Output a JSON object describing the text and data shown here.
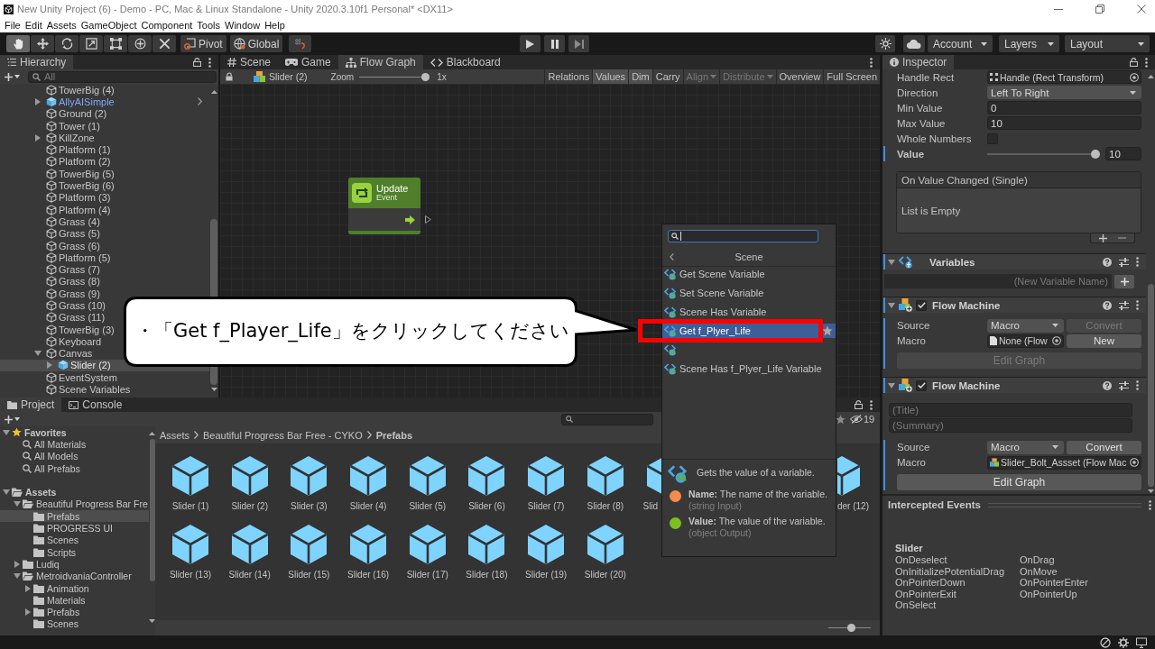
{
  "window": {
    "title": "New Unity Project (6) - Demo - PC, Mac & Linux Standalone - Unity 2020.3.10f1 Personal* <DX11>"
  },
  "menu": [
    "File",
    "Edit",
    "Assets",
    "GameObject",
    "Component",
    "Tools",
    "Window",
    "Help"
  ],
  "toolbar": {
    "tools": [
      {
        "kind": "hand",
        "selected": true
      },
      {
        "kind": "move",
        "selected": false
      },
      {
        "kind": "rotate",
        "selected": false
      },
      {
        "kind": "scale",
        "selected": false
      },
      {
        "kind": "rect",
        "selected": false
      },
      {
        "kind": "transform",
        "selected": false
      },
      {
        "kind": "custom",
        "selected": false
      }
    ],
    "pivot": "Pivot",
    "space": "Global",
    "account": "Account",
    "layers": "Layers",
    "layout": "Layout"
  },
  "hierarchy": {
    "title": "Hierarchy",
    "search_placeholder": "All",
    "items": [
      {
        "label": "TowerBig (4)",
        "kind": "object",
        "selected": false
      },
      {
        "label": "AllyAISimple",
        "kind": "prefab_root",
        "expanded": false,
        "selected": false
      },
      {
        "label": "Ground (2)",
        "kind": "object",
        "selected": false
      },
      {
        "label": "Tower (1)",
        "kind": "object",
        "selected": false
      },
      {
        "label": "KillZone",
        "kind": "object",
        "expanded": false,
        "selected": false
      },
      {
        "label": "Platform (1)",
        "kind": "object",
        "selected": false
      },
      {
        "label": "Platform (2)",
        "kind": "object",
        "selected": false
      },
      {
        "label": "TowerBig (5)",
        "kind": "object",
        "selected": false
      },
      {
        "label": "TowerBig (6)",
        "kind": "object",
        "selected": false
      },
      {
        "label": "Platform (3)",
        "kind": "object",
        "selected": false
      },
      {
        "label": "Platform (4)",
        "kind": "object",
        "selected": false
      },
      {
        "label": "Grass (4)",
        "kind": "object",
        "selected": false
      },
      {
        "label": "Grass (5)",
        "kind": "object",
        "selected": false
      },
      {
        "label": "Grass (6)",
        "kind": "object",
        "selected": false
      },
      {
        "label": "Platform (5)",
        "kind": "object",
        "selected": false
      },
      {
        "label": "Grass (7)",
        "kind": "object",
        "selected": false
      },
      {
        "label": "Grass (8)",
        "kind": "object",
        "selected": false
      },
      {
        "label": "Grass (9)",
        "kind": "object",
        "selected": false
      },
      {
        "label": "Grass (10)",
        "kind": "object",
        "selected": false
      },
      {
        "label": "Grass (11)",
        "kind": "object",
        "selected": false
      },
      {
        "label": "TowerBig (3)",
        "kind": "object",
        "selected": false
      },
      {
        "label": "Keyboard",
        "kind": "object",
        "selected": false
      },
      {
        "label": "Canvas",
        "kind": "object",
        "expanded": true,
        "selected": false,
        "children": [
          {
            "label": "Slider (2)",
            "kind": "prefab",
            "expanded": false,
            "selected": true
          }
        ]
      },
      {
        "label": "EventSystem",
        "kind": "object",
        "selected": false
      },
      {
        "label": "Scene Variables",
        "kind": "object",
        "selected": false
      }
    ]
  },
  "scene_view": {
    "tabs": [
      {
        "label": "Scene",
        "kind": "scene",
        "selected": false
      },
      {
        "label": "Game",
        "kind": "game",
        "selected": false
      },
      {
        "label": "Flow Graph",
        "kind": "graph",
        "selected": true
      },
      {
        "label": "Blackboard",
        "kind": "blackboard",
        "selected": false
      }
    ],
    "breadcrumb": "Slider (2)",
    "zoom_label": "Zoom",
    "zoom": {
      "level": 1
    },
    "zoom_reading": "1x",
    "buttons": [
      {
        "label": "Relations",
        "kind": "toggle",
        "on": false,
        "disabled": false
      },
      {
        "label": "Values",
        "kind": "toggle",
        "on": true,
        "disabled": false
      },
      {
        "label": "Dim",
        "kind": "toggle",
        "on": true,
        "disabled": false
      },
      {
        "label": "Carry",
        "kind": "toggle",
        "on": false,
        "disabled": false
      },
      {
        "label": "Align",
        "kind": "dropdown",
        "on": false,
        "disabled": true
      },
      {
        "label": "Distribute",
        "kind": "dropdown",
        "on": false,
        "disabled": true
      },
      {
        "label": "Overview",
        "kind": "button",
        "on": false,
        "disabled": false
      },
      {
        "label": "Full Screen",
        "kind": "button",
        "on": false,
        "disabled": false
      }
    ],
    "nodes": [
      {
        "title": "Update",
        "subtitle": "Event"
      }
    ]
  },
  "fuzzy_finder": {
    "header": "Scene",
    "items": [
      {
        "label": "Get Scene Variable",
        "selected": false
      },
      {
        "label": "Set Scene Variable",
        "selected": false
      },
      {
        "label": "Scene Has Variable",
        "selected": false
      },
      {
        "label": "Get f_Plyer_Life",
        "selected": true
      },
      {
        "selected": false
      },
      {
        "label": "Scene Has f_Plyer_Life Variable",
        "selected": false
      }
    ],
    "summary": "Gets the value of a variable.",
    "ports": [
      {
        "text": "**Name:** The name of the variable.",
        "type": "(string Input)",
        "color": "#f58b4c"
      },
      {
        "text": "**Value:** The value of the variable.",
        "type": "(object Output)",
        "color": "#7fbf1f"
      }
    ]
  },
  "callout": {
    "text": "・「Get f_Player_Life」をクリックしてください"
  },
  "inspector": {
    "title": "Inspector",
    "fields": [
      {
        "kind": "object",
        "label": "Handle Rect",
        "value": "Handle (Rect Transform)",
        "override": false
      },
      {
        "kind": "dropdown",
        "label": "Direction",
        "value": "Left To Right",
        "override": false
      },
      {
        "kind": "text",
        "label": "Min Value",
        "value": "0",
        "override": false
      },
      {
        "kind": "text",
        "label": "Max Value",
        "value": "10",
        "override": false
      },
      {
        "kind": "checkbox",
        "label": "Whole Numbers",
        "checked": false,
        "override": false
      },
      {
        "kind": "slider",
        "label": "Value",
        "level": 1,
        "value": "10",
        "override": true
      }
    ],
    "event": {
      "title": "On Value Changed (Single)",
      "empty_text": "List is Empty"
    },
    "components": [
      {
        "kind": "variables",
        "title": "Variables",
        "override": true,
        "placeholder": "(New Variable Name)"
      },
      {
        "kind": "machine",
        "title": "Flow Machine",
        "enabled": true,
        "override": true,
        "source_label": "Source",
        "source": "Macro",
        "convert": {
          "label": "Convert",
          "disabled": true
        },
        "macro_label": "Macro",
        "macro": {
          "value": "None (Flow",
          "kind": "empty"
        },
        "new_label": "New",
        "edit": {
          "label": "Edit Graph",
          "disabled": true
        }
      },
      {
        "kind": "machine",
        "title": "Flow Machine",
        "enabled": true,
        "override": true,
        "title_placeholder": "(Title)",
        "summary_placeholder": "(Summary)",
        "source_label": "Source",
        "source": "Macro",
        "convert": {
          "label": "Convert",
          "disabled": false
        },
        "macro_label": "Macro",
        "macro": {
          "value": "Slider_Bolt_Assset (Flow Mac",
          "kind": "asset"
        },
        "edit": {
          "label": "Edit Graph",
          "disabled": false
        }
      }
    ]
  },
  "intercepted_events": {
    "title": "Intercepted Events",
    "group": "Slider",
    "columns": [
      [
        "OnDeselect",
        "OnInitializePotentialDrag",
        "OnPointerDown",
        "OnPointerExit",
        "OnSelect"
      ],
      [
        "OnDrag",
        "OnMove",
        "OnPointerEnter",
        "OnPointerUp"
      ]
    ]
  },
  "project": {
    "tabs": [
      {
        "label": "Project",
        "kind": "project",
        "selected": true
      },
      {
        "label": "Console",
        "kind": "console",
        "selected": false
      }
    ],
    "hidden_count": "19",
    "tree": [
      {
        "label": "Favorites",
        "kind": "favorites",
        "expanded": true,
        "selected": false,
        "children": [
          {
            "label": "All Materials",
            "kind": "search",
            "selected": false
          },
          {
            "label": "All Models",
            "kind": "search",
            "selected": false
          },
          {
            "label": "All Prefabs",
            "kind": "search",
            "selected": false
          }
        ]
      },
      {
        "label": "Assets",
        "kind": "folder",
        "expanded": true,
        "selected": false,
        "children": [
          {
            "label": "Beautiful Progress Bar Fre",
            "kind": "folder",
            "expanded": true,
            "selected": false,
            "children": [
              {
                "label": "Prefabs",
                "kind": "folder",
                "selected": true
              },
              {
                "label": "PROGRESS UI",
                "kind": "folder",
                "selected": false
              },
              {
                "label": "Scenes",
                "kind": "folder",
                "selected": false
              },
              {
                "label": "Scripts",
                "kind": "folder",
                "selected": false
              }
            ]
          },
          {
            "label": "Ludiq",
            "kind": "folder",
            "expanded": false,
            "selected": false
          },
          {
            "label": "MetroidvaniaController",
            "kind": "folder",
            "expanded": true,
            "selected": false,
            "children": [
              {
                "label": "Animation",
                "kind": "folder",
                "expanded": false,
                "selected": false
              },
              {
                "label": "Materials",
                "kind": "folder",
                "selected": false
              },
              {
                "label": "Prefabs",
                "kind": "folder",
                "expanded": false,
                "selected": false
              },
              {
                "label": "Scenes",
                "kind": "folder",
                "selected": false
              }
            ]
          }
        ]
      }
    ],
    "breadcrumb": [
      "Assets",
      "Beautiful Progress Bar Free - CYKO",
      "Prefabs"
    ],
    "asset_rows": [
      {
        "leading": [
          {
            "label": "Slider (1)",
            "kind": "whole"
          },
          {
            "label": "Slider (2)",
            "kind": "whole"
          },
          {
            "label": "Slider (3)",
            "kind": "whole"
          },
          {
            "label": "Slider (4)",
            "kind": "whole"
          },
          {
            "label": "Slider (5)",
            "kind": "whole"
          },
          {
            "label": "Slider (6)",
            "kind": "whole"
          },
          {
            "label": "Slider (7)",
            "kind": "whole"
          },
          {
            "label": "Slider (8)",
            "kind": "whole"
          },
          {
            "label": "Slid",
            "kind": "cut_right"
          }
        ],
        "trailing": [
          {
            "label": "der (12)",
            "kind": "cut_left"
          }
        ]
      },
      {
        "leading": [
          {
            "label": "Slider (13)",
            "kind": "whole"
          },
          {
            "label": "Slider (14)",
            "kind": "whole"
          },
          {
            "label": "Slider (15)",
            "kind": "whole"
          },
          {
            "label": "Slider (16)",
            "kind": "whole"
          },
          {
            "label": "Slider (17)",
            "kind": "whole"
          },
          {
            "label": "Slider (18)",
            "kind": "whole"
          },
          {
            "label": "Slider (19)",
            "kind": "whole"
          },
          {
            "label": "Slider (20)",
            "kind": "whole"
          }
        ]
      }
    ],
    "icon_size": {
      "level": 0.55
    }
  }
}
